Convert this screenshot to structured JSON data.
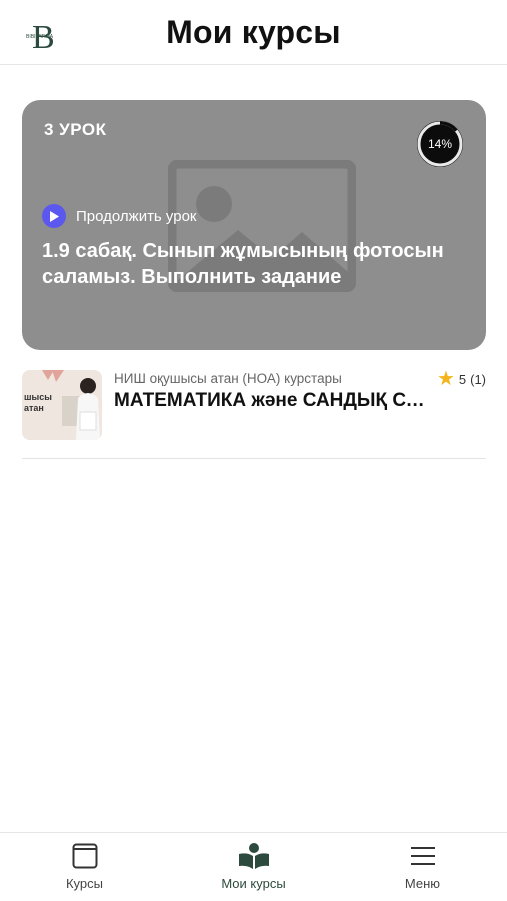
{
  "header": {
    "title": "Мои курсы",
    "logo_letter": "B",
    "logo_caption": "BIBIFATIMA"
  },
  "continue_card": {
    "lesson_label": "3 УРОК",
    "progress_percent": 14,
    "progress_text": "14%",
    "continue_label": "Продолжить урок",
    "lesson_title": "1.9 сабақ. Сынып жұмысының фотосын саламыз. Выполнить задание"
  },
  "courses": [
    {
      "author": "НИШ оқушысы атан (НОА) курстары",
      "title": "МАТЕМАТИКА және САНДЫҚ САУАТТЫЛЫҚ",
      "rating": "5",
      "rating_count": "(1)",
      "thumb_text": "шысы\nатан"
    }
  ],
  "tabbar": {
    "tabs": [
      {
        "label": "Курсы",
        "icon": "courses-icon"
      },
      {
        "label": "Мои курсы",
        "icon": "my-courses-icon",
        "active": true
      },
      {
        "label": "Меню",
        "icon": "menu-icon"
      }
    ]
  },
  "colors": {
    "accent": "#5b58f0",
    "brand_green": "#2c4a3e",
    "card_bg": "#8e8e8e",
    "star": "#f4b41a"
  }
}
